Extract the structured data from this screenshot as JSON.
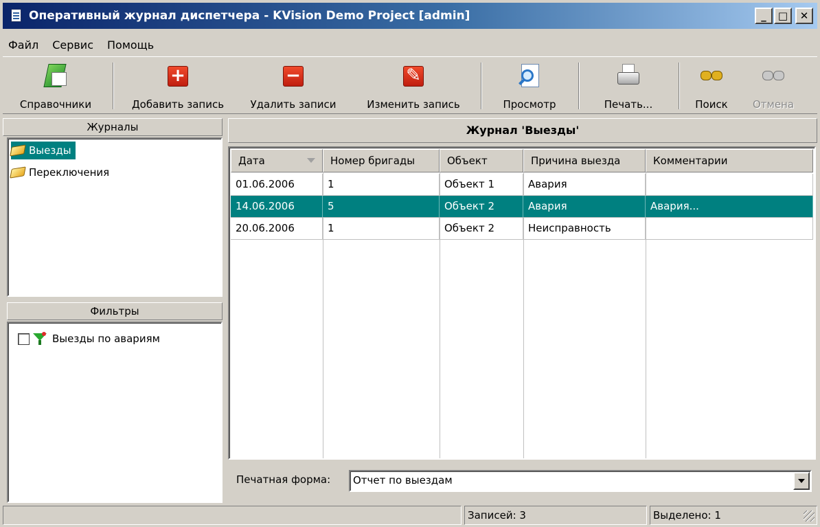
{
  "window": {
    "title": "Оперативный журнал диспетчера - KVision Demo Project [admin]",
    "buttons": {
      "minimize": "_",
      "maximize": "□",
      "close": "✕"
    }
  },
  "menu": [
    "Файл",
    "Сервис",
    "Помощь"
  ],
  "toolbar": {
    "directories": "Справочники",
    "add_record": "Добавить запись",
    "delete_records": "Удалить записи",
    "edit_record": "Изменить запись",
    "preview": "Просмотр",
    "print": "Печать...",
    "search": "Поиск",
    "cancel": "Отмена",
    "icons": {
      "add": "+",
      "delete": "−",
      "edit": "✎"
    }
  },
  "journals": {
    "header": "Журналы",
    "items": [
      "Выезды",
      "Переключения"
    ],
    "selected": "Выезды"
  },
  "filters": {
    "header": "Фильтры",
    "items": [
      {
        "label": "Выезды по авариям",
        "checked": false
      }
    ]
  },
  "main": {
    "title": "Журнал 'Выезды'",
    "columns": [
      "Дата",
      "Номер бригады",
      "Объект",
      "Причина выезда",
      "Комментарии"
    ],
    "rows": [
      [
        "01.06.2006",
        "1",
        "Объект 1",
        "Авария",
        ""
      ],
      [
        "14.06.2006",
        "5",
        "Объект 2",
        "Авария",
        "Авария..."
      ],
      [
        "20.06.2006",
        "1",
        "Объект 2",
        "Неисправность",
        ""
      ]
    ],
    "selected_row": 1
  },
  "print_form": {
    "label": "Печатная форма:",
    "value": "Отчет по выездам"
  },
  "status": {
    "records": "Записей: 3",
    "selected": "Выделено: 1"
  },
  "colors": {
    "selection": "#008080",
    "title_start": "#0a246a",
    "title_end": "#a6caf0",
    "face": "#d4d0c8"
  }
}
